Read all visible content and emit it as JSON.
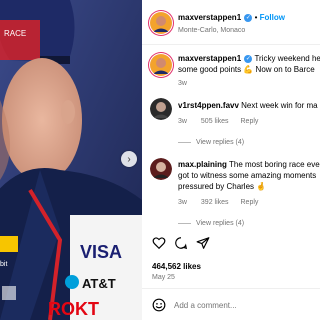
{
  "post": {
    "username": "maxverstappen1",
    "follow_label": "Follow",
    "location": "Monte-Carlo, Monaco",
    "caption": "Tricky weekend here in Monaco but we scored some good points 💪 Now on to Barcelona",
    "caption_line1": "Tricky weekend her",
    "caption_line2": "some good points 💪 Now on to Barce",
    "caption_time": "3w"
  },
  "comments": [
    {
      "username": "v1rst4ppen.favv",
      "text": "Next week win for ma",
      "time": "3w",
      "likes": "505 likes",
      "reply": "Reply",
      "view_replies": "View replies (4)"
    },
    {
      "username": "max.plaining",
      "line1": "The most boring race eve",
      "line2": "got to witness some amazing moments",
      "line3": "pressured by Charles 🤞",
      "time": "3w",
      "likes": "392 likes",
      "reply": "Reply",
      "view_replies": "View replies (4)"
    }
  ],
  "footer": {
    "likes": "464,562 likes",
    "date": "May 25",
    "add_comment_placeholder": "Add a comment..."
  },
  "icons": [
    "verified-icon",
    "heart-icon",
    "comment-icon",
    "share-icon",
    "emoji-icon",
    "chevron-right-icon"
  ],
  "colors": {
    "accent": "#0095f6",
    "verified": "#3897f0",
    "muted": "#737373"
  }
}
